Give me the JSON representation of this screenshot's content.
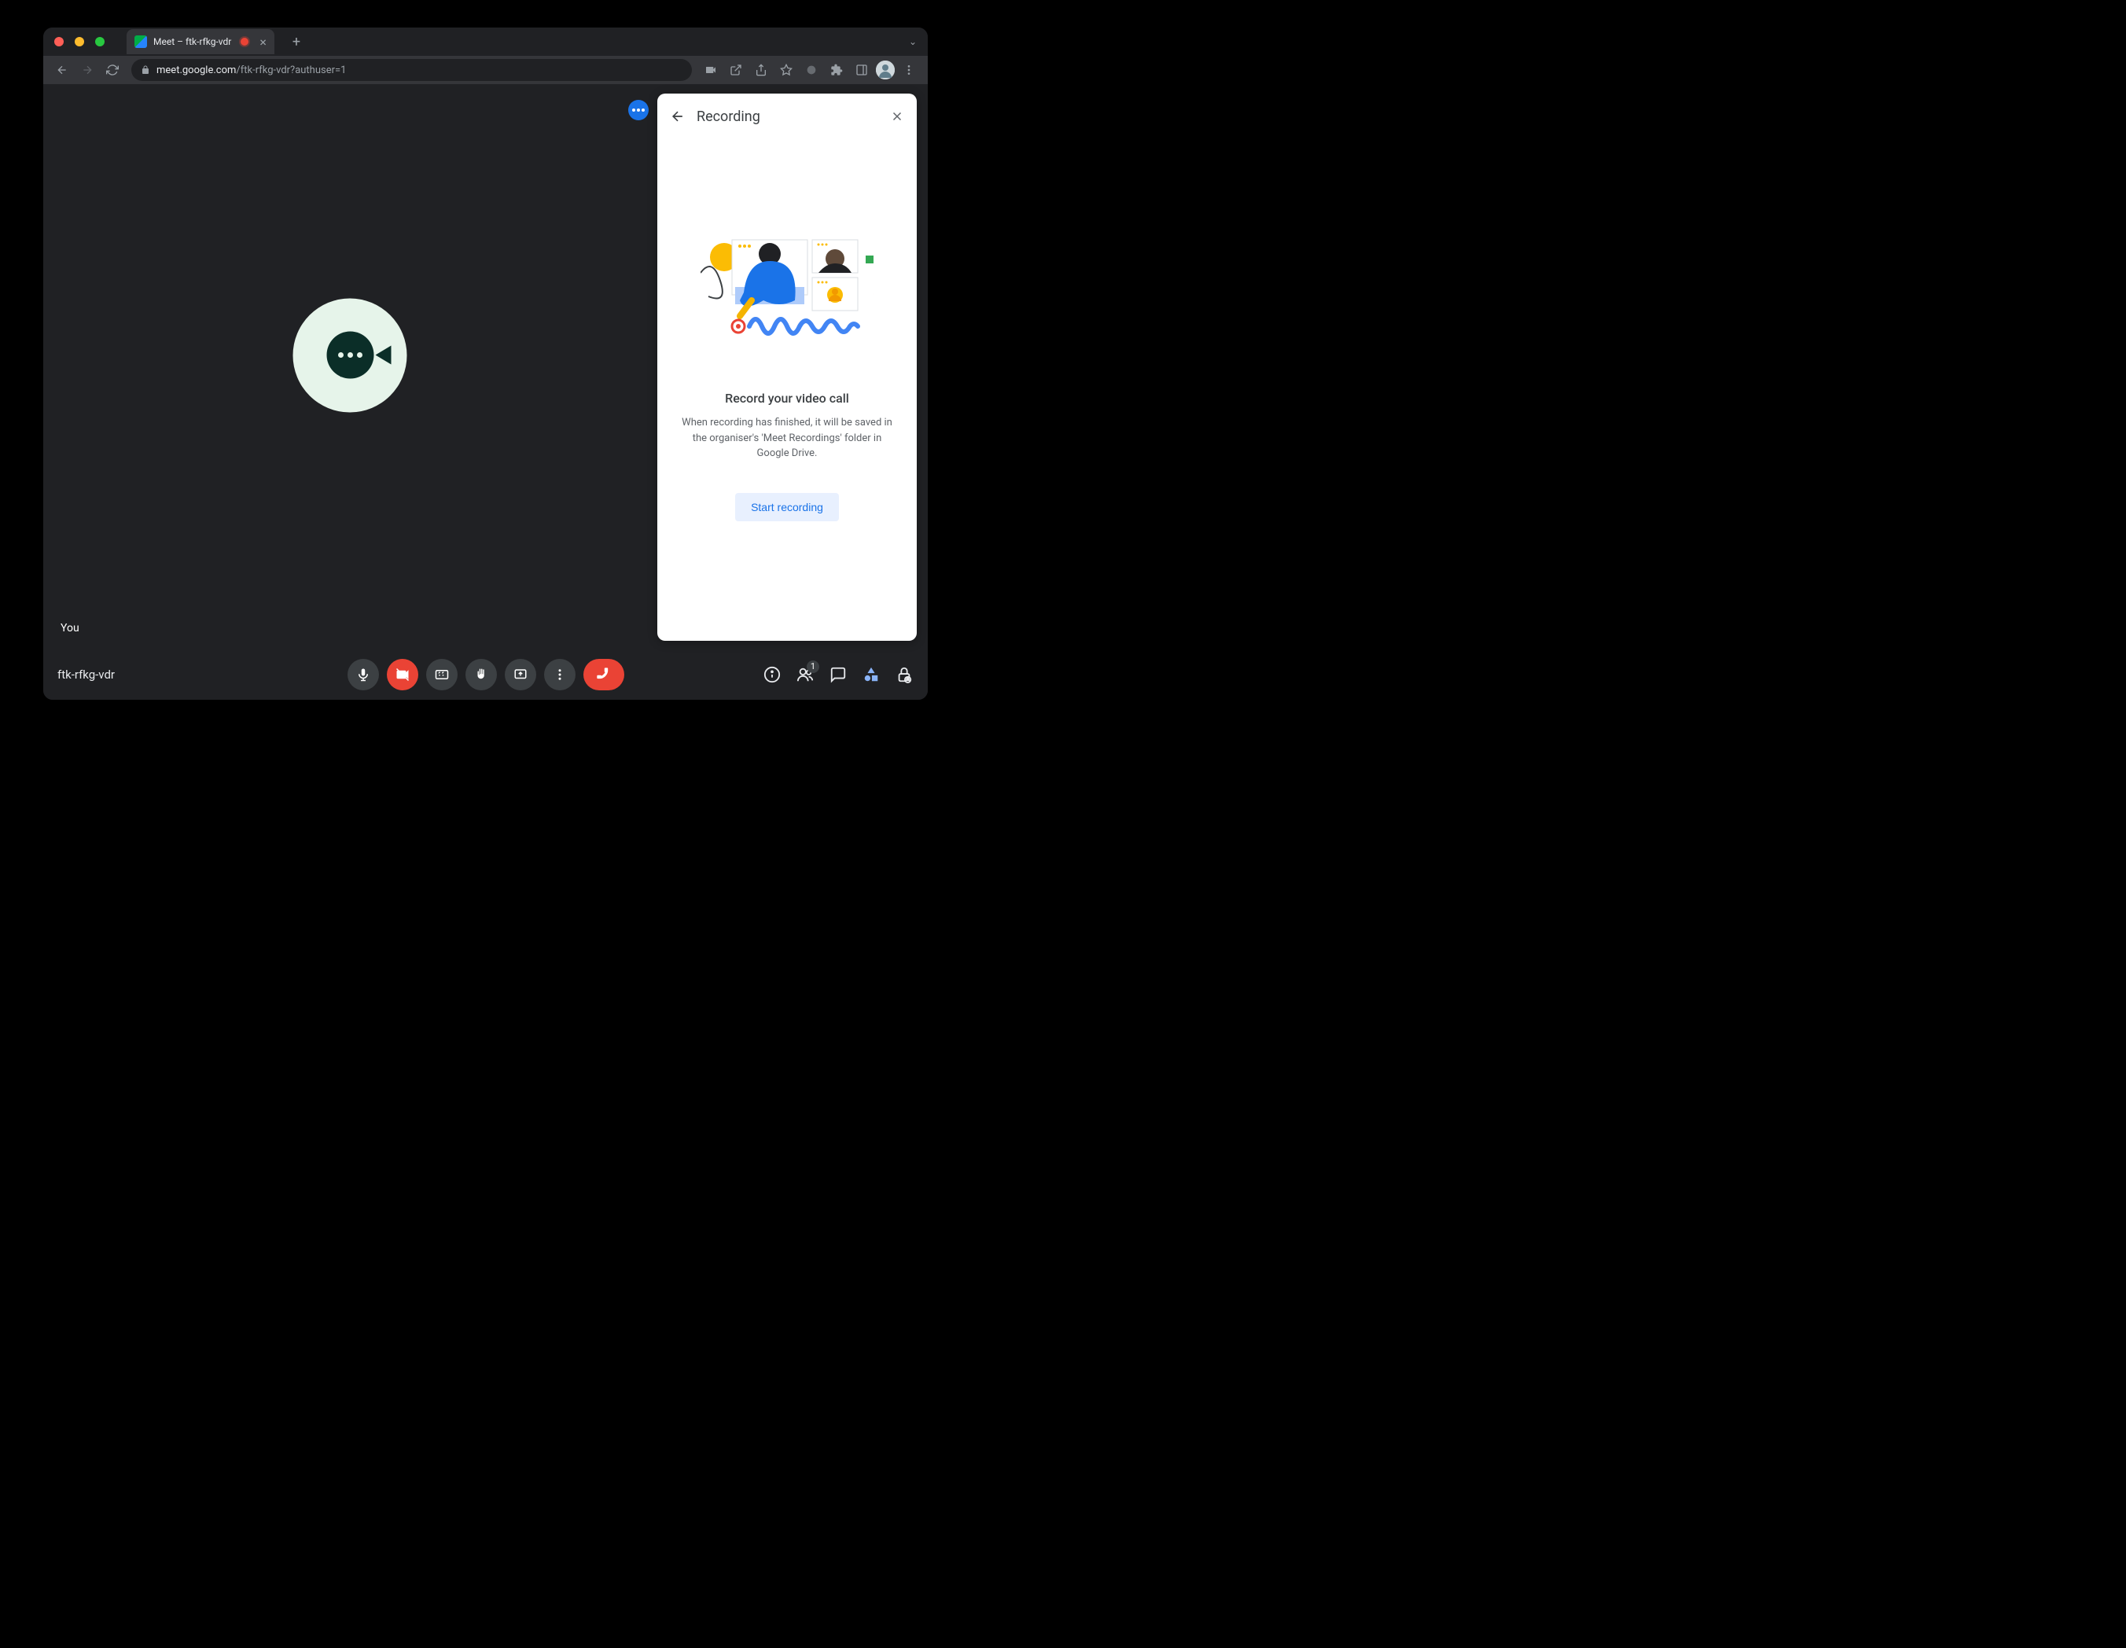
{
  "browser": {
    "tab_title": "Meet – ftk-rfkg-vdr",
    "url_host": "meet.google.com",
    "url_path": "/ftk-rfkg-vdr?authuser=1"
  },
  "stage": {
    "self_label": "You"
  },
  "panel": {
    "title": "Recording",
    "heading": "Record your video call",
    "description": "When recording has finished, it will be saved in the organiser's 'Meet Recordings' folder in Google Drive.",
    "start_button": "Start recording"
  },
  "bottombar": {
    "meeting_code": "ftk-rfkg-vdr",
    "participant_count": "1"
  }
}
